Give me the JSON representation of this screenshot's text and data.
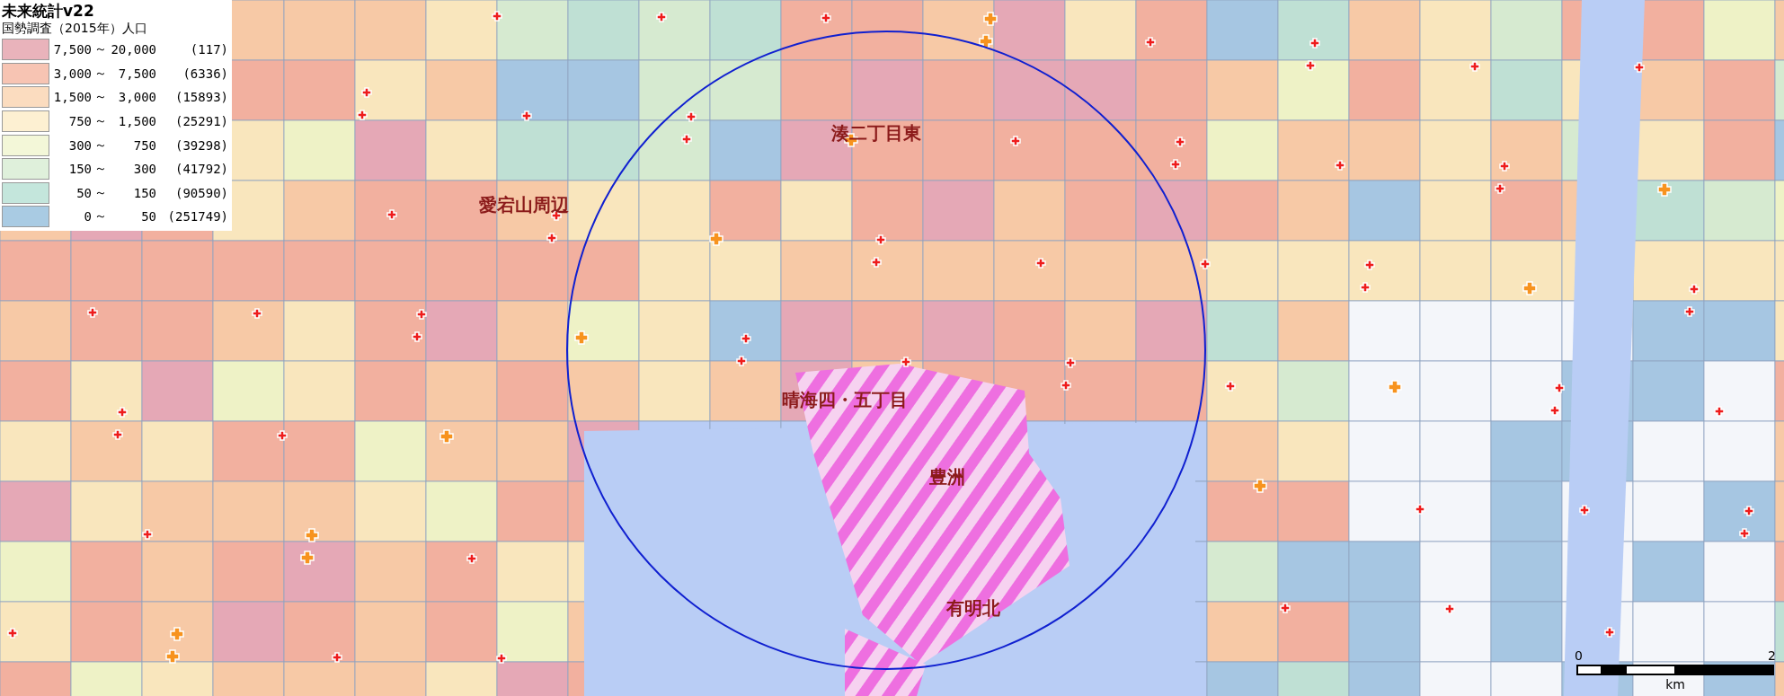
{
  "legend": {
    "title": "未来統計v22",
    "subtitle": "国勢調査（2015年）人口",
    "classes": [
      {
        "from": "7,500",
        "separator": "～",
        "to": "20,000",
        "count": "(117)",
        "color": "#e9b3bb"
      },
      {
        "from": "3,000",
        "separator": "～",
        "to": "7,500",
        "count": "(6336)",
        "color": "#f7c4b3"
      },
      {
        "from": "1,500",
        "separator": "～",
        "to": "3,000",
        "count": "(15893)",
        "color": "#fbdcbf"
      },
      {
        "from": "750",
        "separator": "～",
        "to": "1,500",
        "count": "(25291)",
        "color": "#fdf0d2"
      },
      {
        "from": "300",
        "separator": "～",
        "to": "750",
        "count": "(39298)",
        "color": "#f3f7d8"
      },
      {
        "from": "150",
        "separator": "～",
        "to": "300",
        "count": "(41792)",
        "color": "#dff0db"
      },
      {
        "from": "50",
        "separator": "～",
        "to": "150",
        "count": "(90590)",
        "color": "#c4e6dc"
      },
      {
        "from": "0",
        "separator": "～",
        "to": "50",
        "count": "(251749)",
        "color": "#a9cbe3"
      }
    ]
  },
  "area_labels": [
    {
      "text": "愛宕山周辺"
    },
    {
      "text": "湊二丁目東"
    },
    {
      "text": "晴海四・五丁目"
    },
    {
      "text": "豊洲"
    },
    {
      "text": "有明北"
    }
  ],
  "scale_bar": {
    "start": "0",
    "end": "2",
    "unit": "km"
  }
}
